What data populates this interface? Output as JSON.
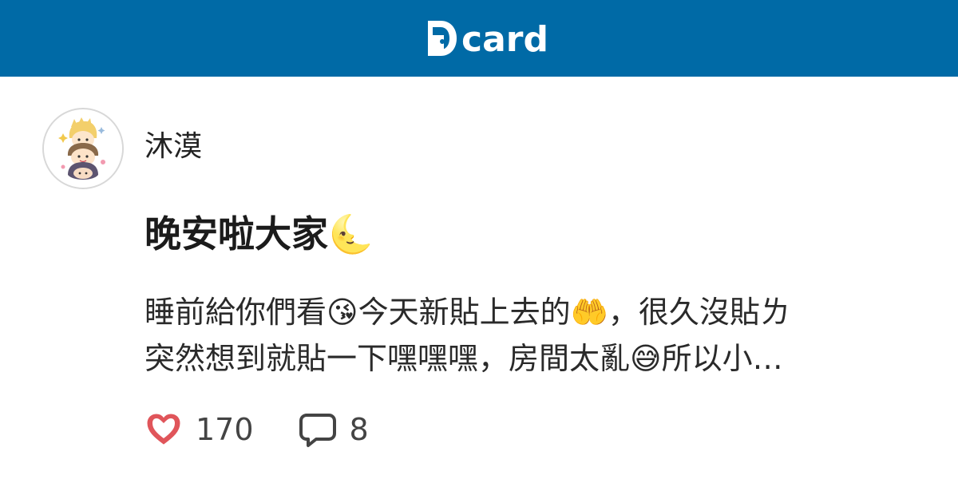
{
  "header": {
    "logo_text": "card",
    "brand_color": "#006aa6"
  },
  "author": {
    "name": "沐漠"
  },
  "post": {
    "title": "晚安啦大家🌜",
    "excerpt_line1": "睡前給你們看😘今天新貼上去的🤲，很久沒貼ㄌ",
    "excerpt_line2": "突然想到就貼一下嘿嘿嘿，房間太亂😅所以小…"
  },
  "stats": {
    "likes": "170",
    "comments": "8",
    "like_icon": "heart-icon",
    "comment_icon": "comment-bubble-icon",
    "like_color": "#e0555a"
  }
}
